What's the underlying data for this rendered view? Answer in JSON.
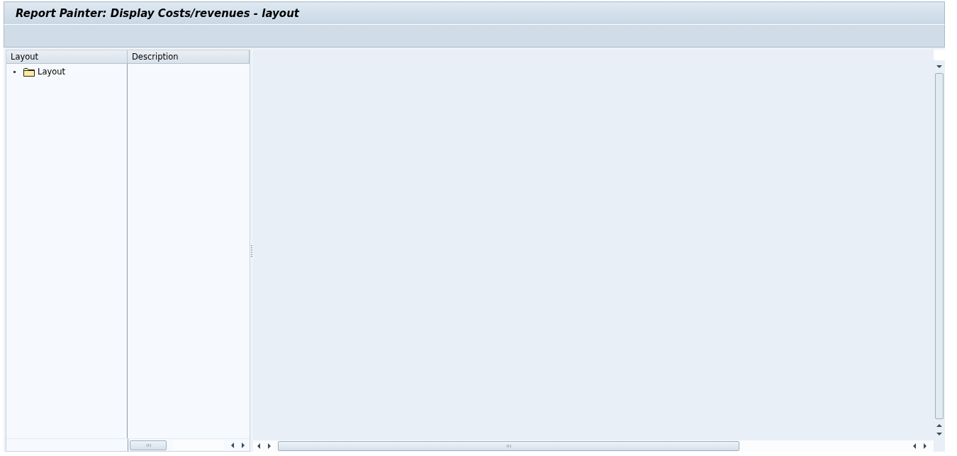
{
  "window": {
    "title": "Report Painter: Display Costs/revenues - layout"
  },
  "tree": {
    "columns": [
      "Layout",
      "Description"
    ],
    "nodes": [
      {
        "label": "Layout"
      }
    ]
  }
}
